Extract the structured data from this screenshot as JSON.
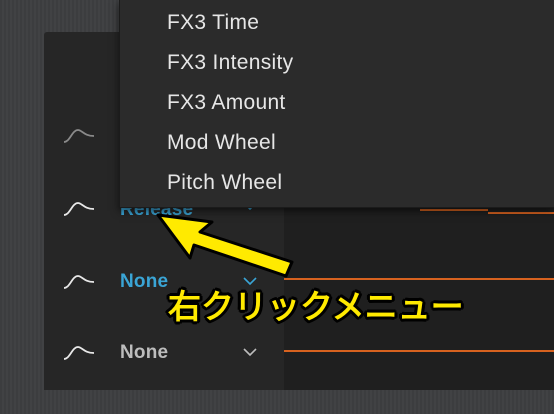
{
  "modulation_rows": [
    {
      "label": "",
      "color": "#3aa5d6"
    },
    {
      "label": "Release",
      "color": "#3aa5d6"
    },
    {
      "label": "None",
      "color": "#3aa5d6"
    },
    {
      "label": "None",
      "color": "#bdbdbd"
    }
  ],
  "context_menu": {
    "items": [
      "FX3 Time",
      "FX3 Intensity",
      "FX3 Amount",
      "Mod Wheel",
      "Pitch Wheel"
    ]
  },
  "annotation": {
    "text": "右クリックメニュー",
    "color": "#ffea00"
  },
  "colors": {
    "accent_orange": "#d7621f",
    "label_blue": "#3aa5d6"
  }
}
